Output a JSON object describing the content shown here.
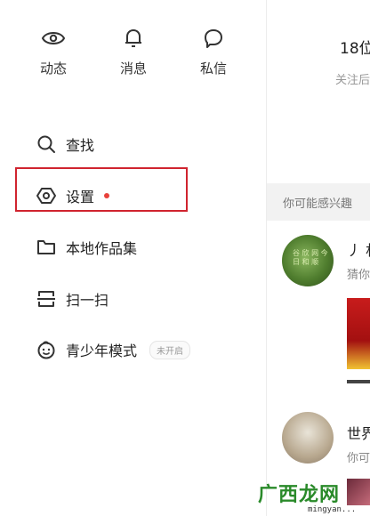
{
  "quick_actions": [
    {
      "label": "动态",
      "icon": "eye-icon"
    },
    {
      "label": "消息",
      "icon": "bell-icon"
    },
    {
      "label": "私信",
      "icon": "chat-bubble-icon"
    }
  ],
  "menu": [
    {
      "label": "查找",
      "icon": "search-icon"
    },
    {
      "label": "设置",
      "icon": "settings-hexagon-icon",
      "dot": true
    },
    {
      "label": "本地作品集",
      "icon": "folder-icon"
    },
    {
      "label": "扫一扫",
      "icon": "scan-icon"
    },
    {
      "label": "青少年模式",
      "icon": "child-face-icon",
      "badge": "未开启"
    }
  ],
  "highlight_color": "#d0242f",
  "dot_color": "#e8413b",
  "background_panel": {
    "title": "18位",
    "subtitle": "关注后",
    "section_header": "你可能感兴趣",
    "users": [
      {
        "name": "丿 林",
        "desc": "猜你"
      },
      {
        "name": "世界",
        "desc": "你可"
      }
    ],
    "avatar_mark": "谷 欣 网 今 日 和 顺"
  },
  "watermark": {
    "logo": "广西龙网",
    "url": "mingyan..."
  }
}
